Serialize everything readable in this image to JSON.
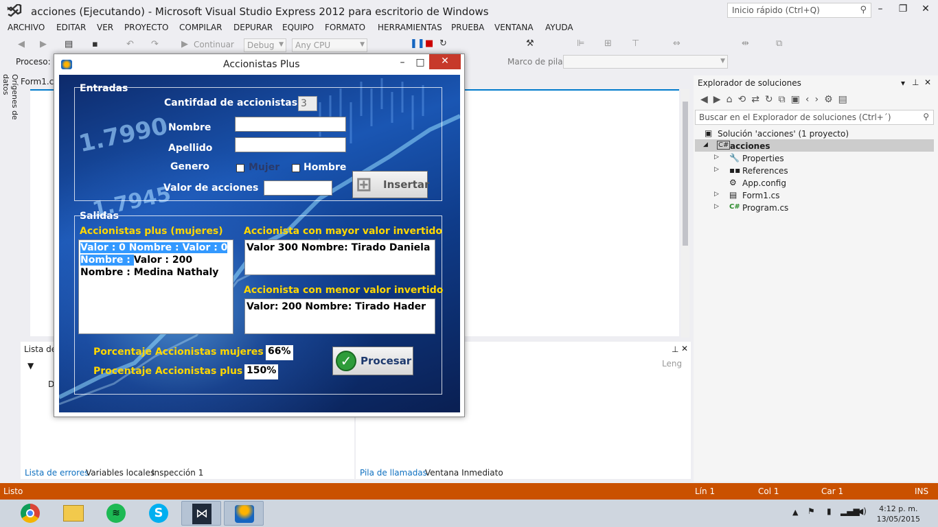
{
  "window": {
    "title": "acciones (Ejecutando) - Microsoft Visual Studio Express 2012 para escritorio de Windows",
    "quick_launch": "Inicio rápido (Ctrl+Q)"
  },
  "menu": [
    "ARCHIVO",
    "EDITAR",
    "VER",
    "PROYECTO",
    "COMPILAR",
    "DEPURAR",
    "EQUIPO",
    "FORMATO",
    "HERRAMIENTAS",
    "PRUEBA",
    "VENTANA",
    "AYUDA"
  ],
  "toolbar": {
    "continue_label": "Continuar",
    "config": "Debug",
    "platform": "Any CPU",
    "process_label": "Proceso:",
    "stack_label": "Marco de pila:"
  },
  "left_sidebar": "Orígenes de datos",
  "editor": {
    "doc_tab": "Form1.c"
  },
  "bottom": {
    "left_tabs": [
      "Lista de errores",
      "Variables locales",
      "Inspección 1"
    ],
    "right_tabs": [
      "Pila de llamadas",
      "Ventana Inmediato"
    ],
    "err_header": "Lista de",
    "col_d": "D",
    "col_len": "Leng"
  },
  "solution_explorer": {
    "title": "Explorador de soluciones",
    "search_placeholder": "Buscar en el Explorador de soluciones (Ctrl+´)",
    "items": [
      "Solución 'acciones'  (1 proyecto)",
      "acciones",
      "Properties",
      "References",
      "App.config",
      "Form1.cs",
      "Program.cs"
    ]
  },
  "status": {
    "ready": "Listo",
    "line": "Lín 1",
    "col": "Col 1",
    "car": "Car 1",
    "ins": "INS"
  },
  "clock": {
    "time": "4:12 p. m.",
    "date": "13/05/2015"
  },
  "app": {
    "title": "Accionistas Plus",
    "bg_text": [
      "1.7990",
      "1.7945"
    ],
    "entradas": {
      "title": "Entradas",
      "count_label": "Cantifdad de accionistas",
      "count_value": "3",
      "name_label": "Nombre",
      "lastname_label": "Apellido",
      "gender_label": "Genero",
      "female": "Mujer",
      "male": "Hombre",
      "value_label": "Valor de acciones",
      "insert_button": "Insertar"
    },
    "salidas": {
      "title": "Salidas",
      "plus_label": "Accionistas plus (mujeres)",
      "plus_list": [
        "Valor : 0 Nombre : Valor : 0",
        "Nombre : ",
        "Valor : 200",
        "Nombre : Medina  Nathaly"
      ],
      "max_label": "Accionista con mayor valor invertido",
      "max_value": "Valor 300 Nombre:  Tirado  Daniela",
      "min_label": "Accionista con menor valor invertido",
      "min_value": "Valor:  200 Nombre:  Tirado  Hader",
      "pct_women_label": "Porcentaje Accionistas mujeres",
      "pct_women": "66%",
      "pct_plus_label": "Procentaje Accionistas plus",
      "pct_plus": "150%",
      "process_button": "Procesar"
    }
  }
}
